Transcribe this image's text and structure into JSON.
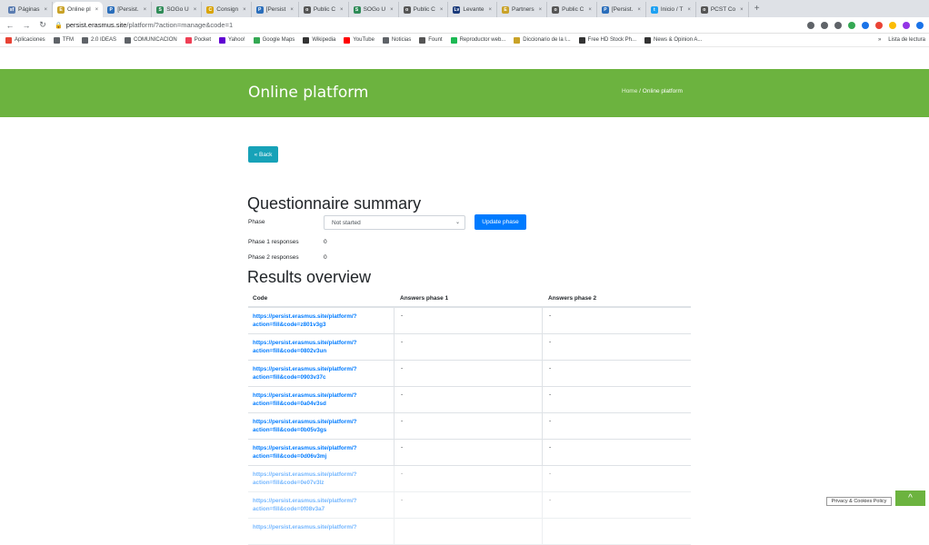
{
  "browser": {
    "tabs": [
      {
        "label": "Páginas",
        "icon": "sf",
        "color": "#5b7db1",
        "active": false
      },
      {
        "label": "Online pl",
        "icon": "E",
        "color": "#c9a227",
        "active": true
      },
      {
        "label": "[Persist.",
        "icon": "P",
        "color": "#2a6ebb",
        "active": false
      },
      {
        "label": "SOGo U",
        "icon": "S",
        "color": "#2e8b57",
        "active": false
      },
      {
        "label": "Consign",
        "icon": "C",
        "color": "#d9a400",
        "active": false
      },
      {
        "label": "[Persist",
        "icon": "P",
        "color": "#2a6ebb",
        "active": false
      },
      {
        "label": "Public C",
        "icon": "o",
        "color": "#555555",
        "active": false
      },
      {
        "label": "SOGo U",
        "icon": "S",
        "color": "#2e8b57",
        "active": false
      },
      {
        "label": "Public C",
        "icon": "o",
        "color": "#555555",
        "active": false
      },
      {
        "label": "Levante",
        "icon": "Lv",
        "color": "#1a3a7a",
        "active": false
      },
      {
        "label": "Partners",
        "icon": "E",
        "color": "#c9a227",
        "active": false
      },
      {
        "label": "Public C",
        "icon": "o",
        "color": "#555555",
        "active": false
      },
      {
        "label": "[Persist.",
        "icon": "P",
        "color": "#2a6ebb",
        "active": false
      },
      {
        "label": "Inicio / T",
        "icon": "t",
        "color": "#1da1f2",
        "active": false
      },
      {
        "label": "PCST Co",
        "icon": "o",
        "color": "#555555",
        "active": false
      }
    ],
    "new_tab": "+",
    "url_host": "persist.erasmus.site",
    "url_path": "/platform/?action=manage&code=1",
    "bookmarks": [
      {
        "label": "Aplicaciones",
        "color": "#e84335"
      },
      {
        "label": "TFM",
        "color": "#5f6368"
      },
      {
        "label": "2.0 IDEAS",
        "color": "#5f6368"
      },
      {
        "label": "COMUNICACION",
        "color": "#5f6368"
      },
      {
        "label": "Pocket",
        "color": "#ef4056"
      },
      {
        "label": "Yahoo!",
        "color": "#6001d2"
      },
      {
        "label": "Google Maps",
        "color": "#34a853"
      },
      {
        "label": "Wikipedia",
        "color": "#333333"
      },
      {
        "label": "YouTube",
        "color": "#ff0000"
      },
      {
        "label": "Noticias",
        "color": "#5f6368"
      },
      {
        "label": "Fount",
        "color": "#555555"
      },
      {
        "label": "Reproductor web...",
        "color": "#1db954"
      },
      {
        "label": "Diccionario de la l...",
        "color": "#c9a227"
      },
      {
        "label": "Free HD Stock Ph...",
        "color": "#333333"
      },
      {
        "label": "News & Opinion A...",
        "color": "#333333"
      }
    ],
    "bookmarks_more": "»",
    "reading_list": "Lista de lectura"
  },
  "header": {
    "title": "Online platform",
    "breadcrumb_home": "Home",
    "breadcrumb_sep": "/",
    "breadcrumb_current": "Online platform"
  },
  "back_button": "« Back",
  "summary": {
    "heading": "Questionnaire summary",
    "phase_label": "Phase",
    "phase_value": "Not started",
    "update_button": "Update phase",
    "phase1_label": "Phase 1 responses",
    "phase1_value": "0",
    "phase2_label": "Phase 2 responses",
    "phase2_value": "0"
  },
  "results": {
    "heading": "Results overview",
    "columns": [
      "Code",
      "Answers phase 1",
      "Answers phase 2"
    ],
    "rows": [
      {
        "link_a": "https://persist.erasmus.site/platform/?",
        "link_b": "action=fill&code=z801v3g3",
        "p1": "-",
        "p2": "-"
      },
      {
        "link_a": "https://persist.erasmus.site/platform/?",
        "link_b": "action=fill&code=0802v3un",
        "p1": "-",
        "p2": "-"
      },
      {
        "link_a": "https://persist.erasmus.site/platform/?",
        "link_b": "action=fill&code=0903v37c",
        "p1": "-",
        "p2": "-"
      },
      {
        "link_a": "https://persist.erasmus.site/platform/?",
        "link_b": "action=fill&code=0a04v3sd",
        "p1": "-",
        "p2": "-"
      },
      {
        "link_a": "https://persist.erasmus.site/platform/?",
        "link_b": "action=fill&code=0b05v3gs",
        "p1": "-",
        "p2": "-"
      },
      {
        "link_a": "https://persist.erasmus.site/platform/?",
        "link_b": "action=fill&code=0d06v3mj",
        "p1": "-",
        "p2": "-"
      },
      {
        "link_a": "https://persist.erasmus.site/platform/?",
        "link_b": "action=fill&code=0e07v3lz",
        "p1": "-",
        "p2": "-"
      },
      {
        "link_a": "https://persist.erasmus.site/platform/?",
        "link_b": "action=fill&code=0f08v3a7",
        "p1": "-",
        "p2": "-"
      },
      {
        "link_a": "https://persist.erasmus.site/platform/?",
        "link_b": "",
        "p1": "",
        "p2": ""
      }
    ]
  },
  "footer": {
    "cookie_button": "Privacy & Cookies Policy",
    "top_button": "^"
  }
}
